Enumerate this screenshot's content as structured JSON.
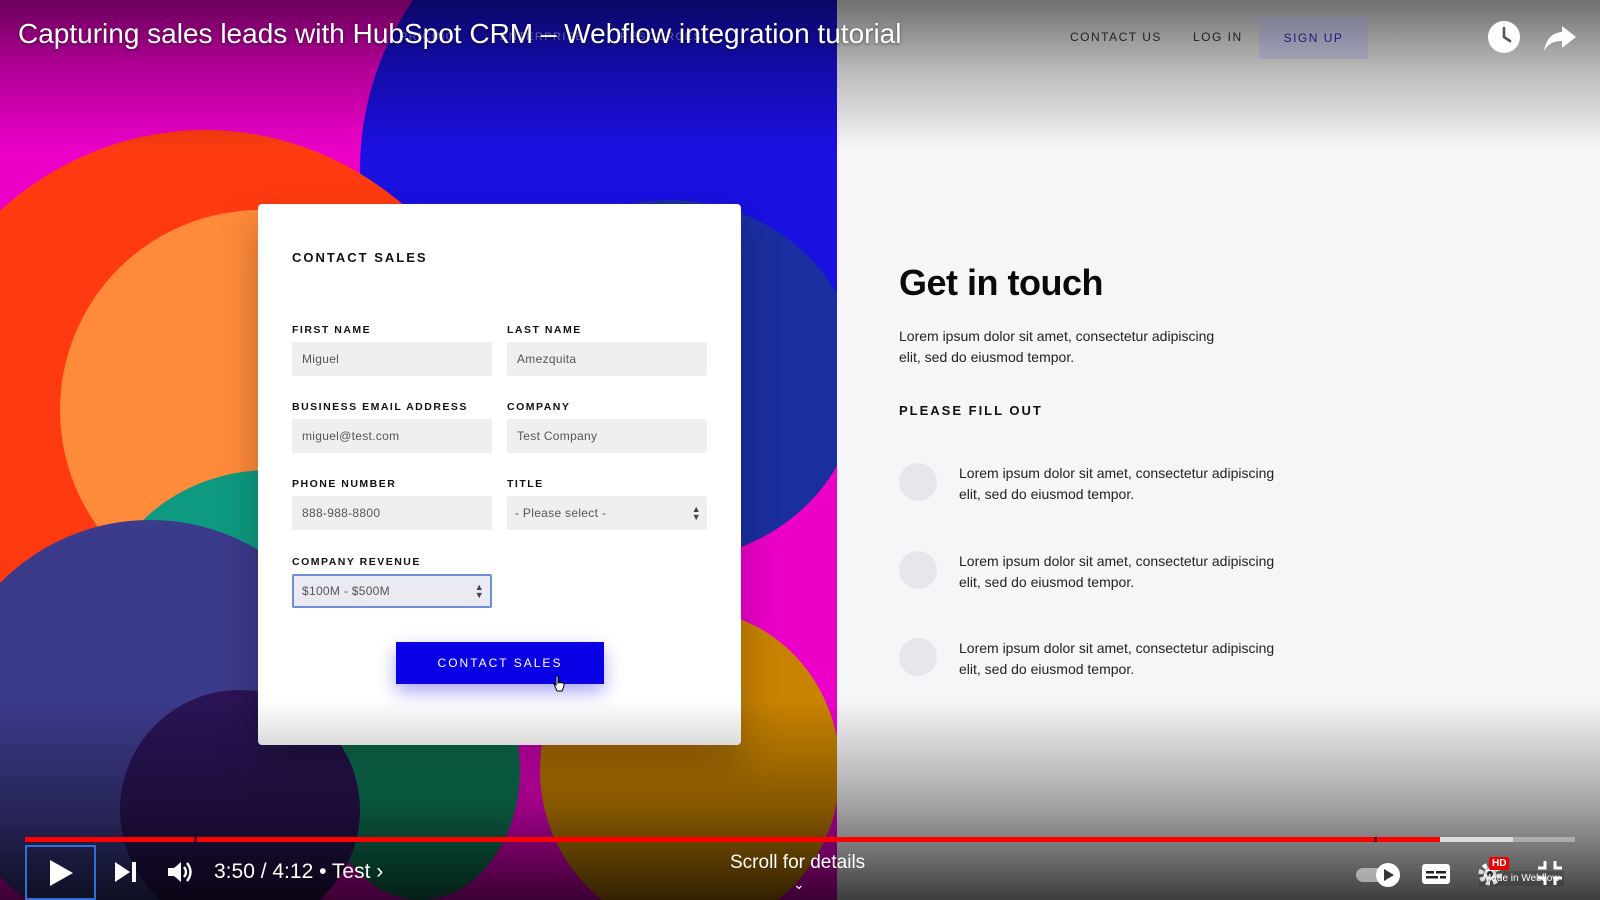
{
  "video": {
    "title": "Capturing sales leads with HubSpot CRM – Webflow integration tutorial",
    "time": "3:50 / 4:12",
    "chapter": "Test",
    "scroll_hint": "Scroll for details",
    "progress_fraction": 0.913,
    "buffered_fraction": 0.96
  },
  "site_nav": {
    "contact_us": "CONTACT US",
    "log_in": "LOG IN",
    "sign_up": "SIGN UP",
    "ghost_items": [
      "PRICING",
      "ENTERPRISE",
      "RESOURCES"
    ]
  },
  "form": {
    "heading": "CONTACT SALES",
    "first_name_label": "FIRST NAME",
    "first_name_value": "Miguel",
    "last_name_label": "LAST NAME",
    "last_name_value": "Amezquita",
    "email_label": "BUSINESS EMAIL ADDRESS",
    "email_value": "miguel@test.com",
    "company_label": "COMPANY",
    "company_value": "Test Company",
    "phone_label": "PHONE NUMBER",
    "phone_value": "888-988-8800",
    "title_label": "TITLE",
    "title_value": "- Please select -",
    "revenue_label": "COMPANY REVENUE",
    "revenue_value": "$100M - $500M",
    "submit_label": "CONTACT SALES"
  },
  "info": {
    "heading": "Get in touch",
    "intro": "Lorem ipsum dolor sit amet, consectetur adipiscing elit, sed do eiusmod tempor.",
    "subheading": "PLEASE FILL OUT",
    "items": [
      "Lorem ipsum dolor sit amet, consectetur adipiscing elit, sed do eiusmod tempor.",
      "Lorem ipsum dolor sit amet, consectetur adipiscing elit, sed do eiusmod tempor.",
      "Lorem ipsum dolor sit amet, consectetur adipiscing elit, sed do eiusmod tempor."
    ]
  },
  "badges": {
    "hd": "HD",
    "made_in": "Made in Webflow"
  },
  "colors": {
    "accent_blue": "#0a00e6",
    "progress_red": "#ff0000"
  }
}
